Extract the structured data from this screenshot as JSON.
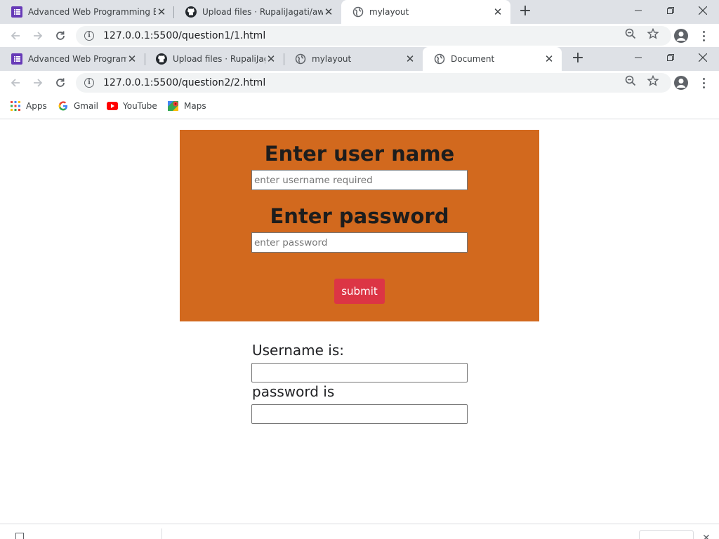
{
  "window1": {
    "tabs": [
      {
        "title": "Advanced Web Programming En"
      },
      {
        "title": "Upload files · RupaliJagati/awpfin"
      },
      {
        "title": "mylayout",
        "active": true
      }
    ],
    "url": "127.0.0.1:5500/question1/1.html"
  },
  "window2": {
    "tabs": [
      {
        "title": "Advanced Web Programm"
      },
      {
        "title": "Upload files · RupaliJagati"
      },
      {
        "title": "mylayout"
      },
      {
        "title": "Document",
        "active": true
      }
    ],
    "url": "127.0.0.1:5500/question2/2.html"
  },
  "bookmarks": [
    {
      "label": "Apps",
      "icon": "apps-grid-icon"
    },
    {
      "label": "Gmail",
      "icon": "google-icon"
    },
    {
      "label": "YouTube",
      "icon": "youtube-icon"
    },
    {
      "label": "Maps",
      "icon": "maps-icon"
    }
  ],
  "form": {
    "username_heading": "Enter user name",
    "username_placeholder": "enter username required",
    "username_value": "",
    "password_heading": "Enter password",
    "password_placeholder": "enter password",
    "password_value": "",
    "submit_label": "submit"
  },
  "output": {
    "username_label": "Username is:",
    "username_value": "",
    "password_label": "password is",
    "password_value": ""
  },
  "download_bar": {
    "file": "",
    "show_all": ""
  },
  "colors": {
    "form_background": "#d2691e",
    "submit_button": "#dc3545",
    "tabstrip": "#dee1e6"
  }
}
